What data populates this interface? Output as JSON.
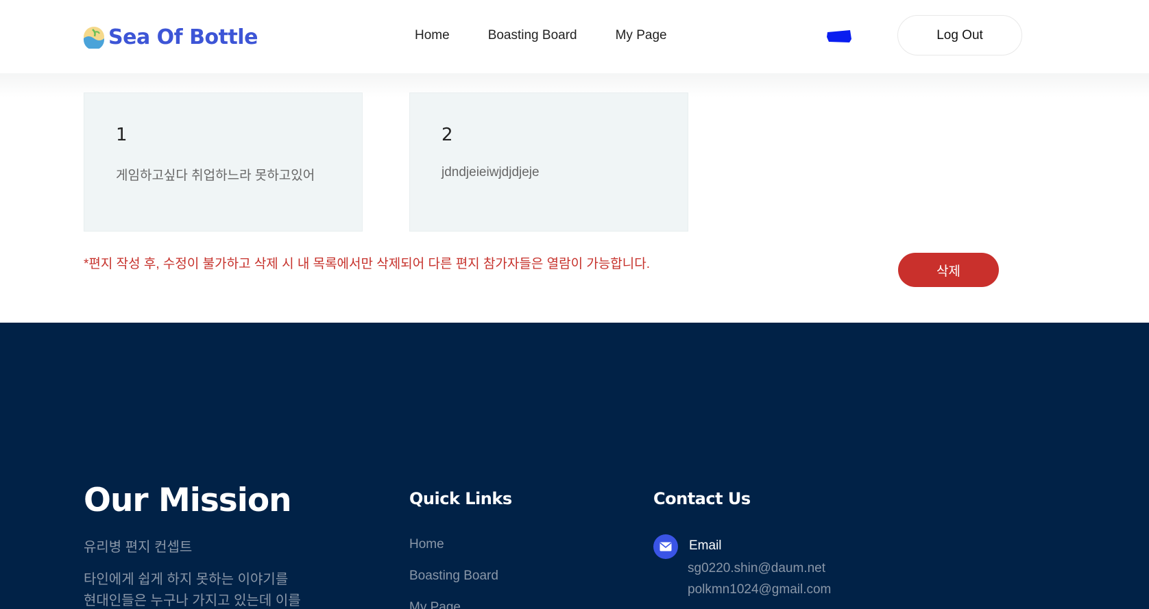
{
  "header": {
    "brand": "Sea Of Bottle",
    "nav": [
      "Home",
      "Boasting Board",
      "My Page"
    ],
    "logout_label": "Log Out"
  },
  "cards": [
    {
      "number": "1",
      "text": "게임하고싶다 취업하느라 못하고있어"
    },
    {
      "number": "2",
      "text": "jdndjeieiwjdjdjeje"
    }
  ],
  "notice": "*편지 작성 후, 수정이 불가하고 삭제 시 내 목록에서만 삭제되어 다른 편지 참가자들은 열람이 가능합니다.",
  "delete_label": "삭제",
  "footer": {
    "mission_title": "Our Mission",
    "mission_subtitle": "유리병 편지 컨셉트",
    "mission_body_1": "타인에게 쉽게 하지 못하는 이야기를",
    "mission_body_2": "현대인들은 누구나 가지고 있는데 이를",
    "quick_links_title": "Quick Links",
    "quick_links": [
      "Home",
      "Boasting Board",
      "My Page"
    ],
    "contact_title": "Contact Us",
    "email_label": "Email",
    "emails": [
      "sg0220.shin@daum.net",
      "polkmn1024@gmail.com"
    ]
  },
  "colors": {
    "brand_blue": "#3d55d6",
    "delete_red": "#c9302c",
    "footer_navy": "#012247",
    "card_bg": "#f0f5f6"
  }
}
